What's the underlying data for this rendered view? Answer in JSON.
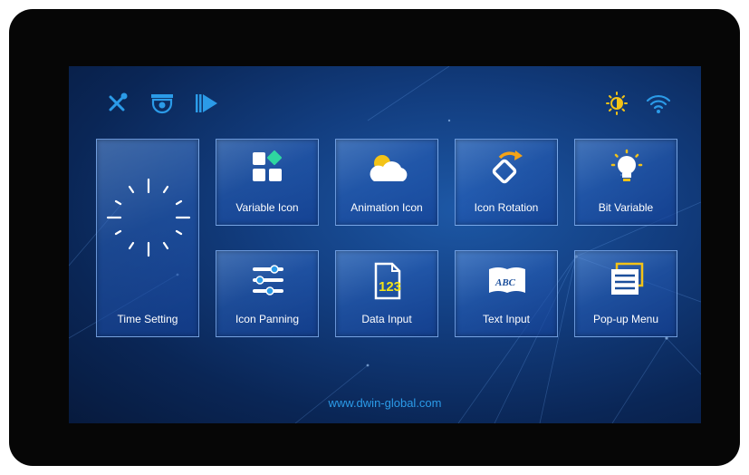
{
  "top_icons": {
    "left": [
      "wrench-screwdriver-icon",
      "camera-icon",
      "play-icon"
    ],
    "right": [
      "brightness-icon",
      "wifi-icon"
    ]
  },
  "tiles": {
    "time_setting": {
      "label": "Time Setting",
      "icon": "clock-icon"
    },
    "variable_icon": {
      "label": "Variable Icon",
      "icon": "variable-icon"
    },
    "animation_icon": {
      "label": "Animation Icon",
      "icon": "cloud-sun-icon"
    },
    "icon_rotation": {
      "label": "Icon Rotation",
      "icon": "rotation-icon"
    },
    "bit_variable": {
      "label": "Bit Variable",
      "icon": "lightbulb-icon"
    },
    "icon_panning": {
      "label": "Icon Panning",
      "icon": "sliders-icon"
    },
    "data_input": {
      "label": "Data Input",
      "icon": "number-file-icon"
    },
    "text_input": {
      "label": "Text Input",
      "icon": "book-abc-icon"
    },
    "popup_menu": {
      "label": "Pop-up Menu",
      "icon": "menu-icon"
    }
  },
  "footer": {
    "url": "www.dwin-global.com"
  },
  "colors": {
    "accent": "#2b9be8",
    "yellow": "#f3c317",
    "screen_bg": "#123d7f"
  }
}
